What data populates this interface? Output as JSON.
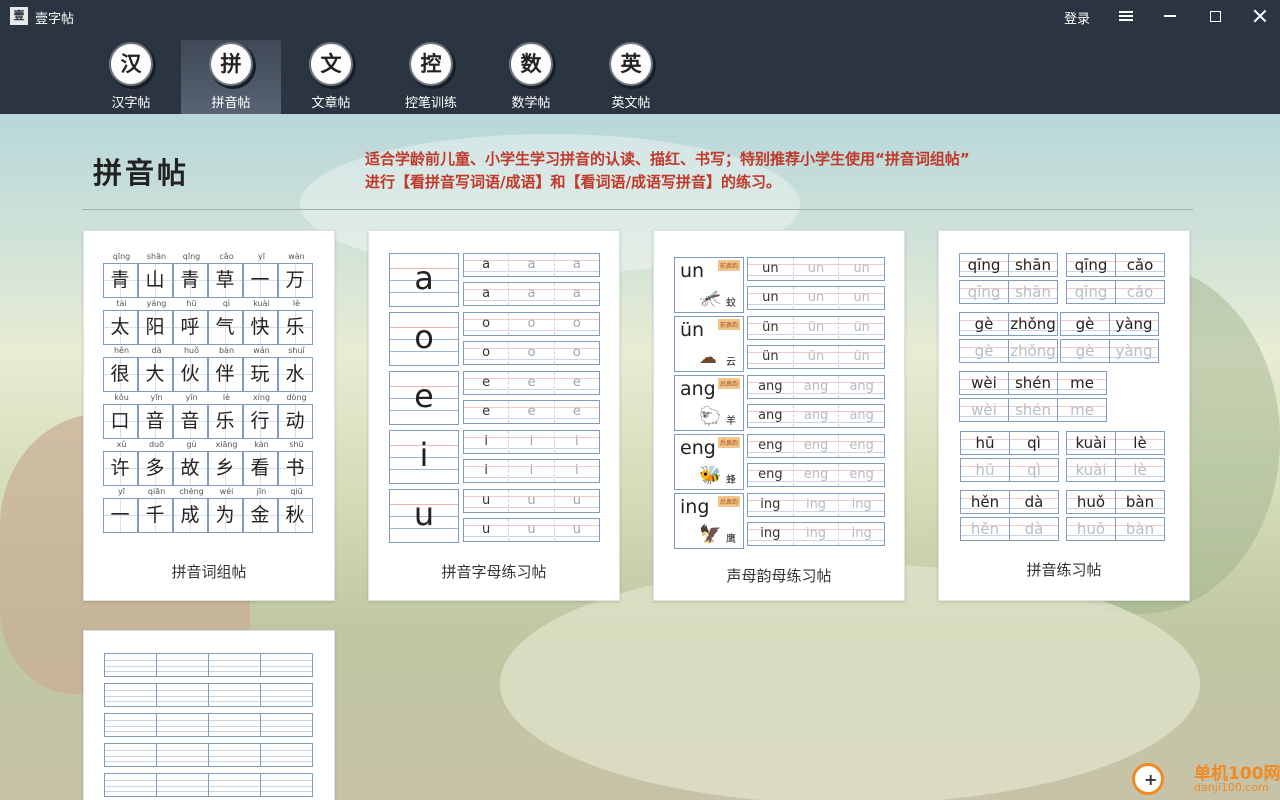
{
  "app": {
    "title": "壹字帖",
    "icon_char": "壹",
    "login_label": "登录"
  },
  "nav": [
    {
      "label": "汉字帖",
      "badge": "汉"
    },
    {
      "label": "拼音帖",
      "badge": "拼",
      "active": true
    },
    {
      "label": "文章帖",
      "badge": "文"
    },
    {
      "label": "控笔训练",
      "badge": "控"
    },
    {
      "label": "数学帖",
      "badge": "数"
    },
    {
      "label": "英文帖",
      "badge": "英"
    }
  ],
  "page": {
    "heading": "拼音帖",
    "description_line1": "适合学龄前儿童、小学生学习拼音的认读、描红、书写；特别推荐小学生使用“拼音词组帖”",
    "description_line2": "进行【看拼音写词语/成语】和【看词语/成语写拼音】的练习。"
  },
  "cards": {
    "c1": {
      "label": "拼音词组帖",
      "rows": [
        [
          [
            "qīng",
            "青"
          ],
          [
            "shān",
            "山"
          ],
          [
            "qīng",
            "青"
          ],
          [
            "cǎo",
            "草"
          ],
          [
            "yī",
            "一"
          ],
          [
            "wàn",
            "万"
          ]
        ],
        [
          [
            "tài",
            "太"
          ],
          [
            "yáng",
            "阳"
          ],
          [
            "hū",
            "呼"
          ],
          [
            "qì",
            "气"
          ],
          [
            "kuài",
            "快"
          ],
          [
            "lè",
            "乐"
          ]
        ],
        [
          [
            "hěn",
            "很"
          ],
          [
            "dà",
            "大"
          ],
          [
            "huǒ",
            "伙"
          ],
          [
            "bàn",
            "伴"
          ],
          [
            "wán",
            "玩"
          ],
          [
            "shuǐ",
            "水"
          ]
        ],
        [
          [
            "kǒu",
            "口"
          ],
          [
            "yīn",
            "音"
          ],
          [
            "yīn",
            "音"
          ],
          [
            "lè",
            "乐"
          ],
          [
            "xíng",
            "行"
          ],
          [
            "dòng",
            "动"
          ]
        ],
        [
          [
            "xǔ",
            "许"
          ],
          [
            "duō",
            "多"
          ],
          [
            "gù",
            "故"
          ],
          [
            "xiāng",
            "乡"
          ],
          [
            "kàn",
            "看"
          ],
          [
            "shū",
            "书"
          ]
        ],
        [
          [
            "yī",
            "一"
          ],
          [
            "qiān",
            "千"
          ],
          [
            "chéng",
            "成"
          ],
          [
            "wéi",
            "为"
          ],
          [
            "jīn",
            "金"
          ],
          [
            "qiū",
            "秋"
          ]
        ]
      ]
    },
    "c2": {
      "label": "拼音字母练习帖",
      "rows": [
        {
          "big": "a",
          "l1": [
            "a",
            "a",
            "a"
          ],
          "l2": [
            "a",
            "a",
            "a"
          ]
        },
        {
          "big": "o",
          "l1": [
            "o",
            "o",
            "o"
          ],
          "l2": [
            "o",
            "o",
            "o"
          ]
        },
        {
          "big": "e",
          "l1": [
            "e",
            "e",
            "e"
          ],
          "l2": [
            "e",
            "e",
            "e"
          ]
        },
        {
          "big": "i",
          "l1": [
            "i",
            "i",
            "i"
          ],
          "l2": [
            "i",
            "i",
            "i"
          ]
        },
        {
          "big": "u",
          "l1": [
            "u",
            "u",
            "u"
          ],
          "l2": [
            "u",
            "u",
            "u"
          ]
        }
      ]
    },
    "c3": {
      "label": "声母韵母练习帖",
      "rows": [
        {
          "py": "un",
          "tag": "前鼻韵",
          "img": "🦟",
          "ch": "蚊",
          "l": [
            "un",
            "un",
            "un"
          ]
        },
        {
          "py": "ün",
          "tag": "前鼻韵",
          "img": "☁",
          "ch": "云",
          "l": [
            "ün",
            "ün",
            "ün"
          ]
        },
        {
          "py": "ang",
          "tag": "后鼻韵",
          "img": "🐑",
          "ch": "羊",
          "l": [
            "ang",
            "ang",
            "ang"
          ]
        },
        {
          "py": "eng",
          "tag": "后鼻韵",
          "img": "🐝",
          "ch": "蜂",
          "l": [
            "eng",
            "eng",
            "eng"
          ]
        },
        {
          "py": "ing",
          "tag": "后鼻韵",
          "img": "🦅",
          "ch": "鹰",
          "l": [
            "ing",
            "ing",
            "ing"
          ]
        }
      ]
    },
    "c4": {
      "label": "拼音练习帖",
      "groups": [
        [
          "qīng",
          "shān"
        ],
        [
          "qīng",
          "cǎo"
        ],
        [
          "gè",
          "zhǒng"
        ],
        [
          "gè",
          "yàng"
        ],
        [
          "wèi",
          "shén",
          "me"
        ],
        [
          "hū",
          "qì"
        ],
        [
          "kuài",
          "lè"
        ],
        [
          "hěn",
          "dà"
        ],
        [
          "huǒ",
          "bàn"
        ]
      ]
    }
  },
  "watermark": {
    "text": "单机100网",
    "sub": "danji100.com"
  }
}
